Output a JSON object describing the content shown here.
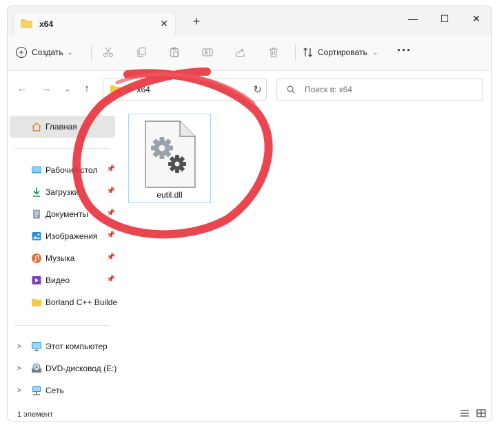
{
  "window": {
    "tab_title": "x64",
    "tab_close": "✕",
    "new_tab": "+",
    "minimize": "—",
    "maximize": "☐",
    "close": "✕"
  },
  "toolbar": {
    "create_label": "Создать",
    "sort_label": "Сортировать",
    "more_label": "···"
  },
  "navigation": {
    "back": "←",
    "forward": "→",
    "recent": "⌄",
    "up": "↑",
    "address_path": "x64",
    "search_placeholder": "Поиск в: x64"
  },
  "sidebar": {
    "home": "Главная",
    "pinned": [
      {
        "label": "Рабочий стол",
        "icon": "desktop-icon"
      },
      {
        "label": "Загрузки",
        "icon": "download-icon"
      },
      {
        "label": "Документы",
        "icon": "documents-icon"
      },
      {
        "label": "Изображения",
        "icon": "pictures-icon"
      },
      {
        "label": "Музыка",
        "icon": "music-icon"
      },
      {
        "label": "Видео",
        "icon": "video-icon"
      }
    ],
    "folder": "Borland C++ Builder",
    "devices": [
      {
        "label": "Этот компьютер",
        "icon": "computer-icon"
      },
      {
        "label": "DVD-дисковод (E:)",
        "icon": "dvd-icon"
      },
      {
        "label": "Сеть",
        "icon": "network-icon"
      }
    ]
  },
  "content": {
    "files": [
      {
        "name": "eutil.dll",
        "icon": "dll-file-icon"
      }
    ]
  },
  "status": {
    "item_count": "1 элемент"
  },
  "colors": {
    "annotation_circle": "#e8323c",
    "selection_border": "#a9d6f5",
    "folder_yellow": "#f7c948"
  }
}
